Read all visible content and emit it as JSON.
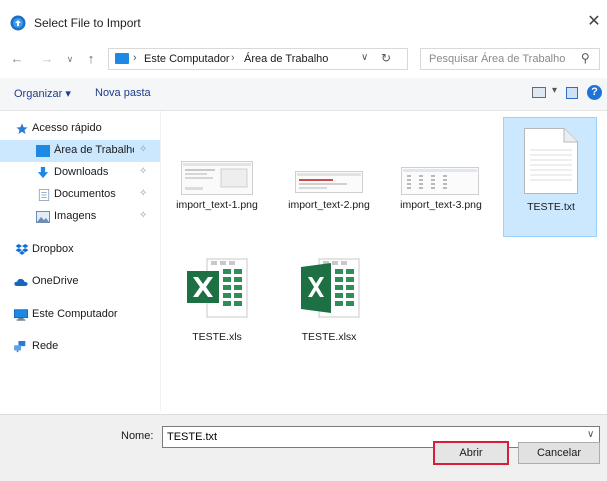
{
  "window": {
    "title": "Select File to Import",
    "close_glyph": "✕"
  },
  "nav": {
    "back": "←",
    "forward": "→",
    "recent": "∨",
    "up": "↑"
  },
  "address": {
    "separator": "›",
    "crumbs": [
      "Este Computador",
      "Área de Trabalho"
    ],
    "dropdown": "∨",
    "refresh": "↻"
  },
  "search": {
    "placeholder": "Pesquisar Área de Trabalho"
  },
  "toolbar": {
    "organize_label": "Organizar ▾",
    "new_folder_label": "Nova pasta",
    "view_dropdown": "▾",
    "help_label": "?"
  },
  "sidebar": {
    "pin_glyph": "✧",
    "items": [
      {
        "label": "Acesso rápido",
        "icon": "star-icon",
        "color": "#2a7bd6"
      },
      {
        "label": "Área de Trabalho",
        "icon": "desktop-icon",
        "color": "#1e88e5"
      },
      {
        "label": "Downloads",
        "icon": "download-icon",
        "color": "#1e88e5"
      },
      {
        "label": "Documentos",
        "icon": "documents-icon",
        "color": "#8aa2c0"
      },
      {
        "label": "Imagens",
        "icon": "images-icon",
        "color": "#6f8db3"
      },
      {
        "label": "Dropbox",
        "icon": "dropbox-icon",
        "color": "#0d6eda"
      },
      {
        "label": "OneDrive",
        "icon": "onedrive-icon",
        "color": "#1565c0"
      },
      {
        "label": "Este Computador",
        "icon": "computer-icon",
        "color": "#1e88e5"
      },
      {
        "label": "Rede",
        "icon": "network-icon",
        "color": "#2a7bd6"
      }
    ]
  },
  "files": [
    {
      "name": "import_text-1.png",
      "type": "png-screenshot"
    },
    {
      "name": "import_text-2.png",
      "type": "png-screenshot"
    },
    {
      "name": "import_text-3.png",
      "type": "png-screenshot"
    },
    {
      "name": "TESTE.txt",
      "type": "text-document",
      "selected": true
    },
    {
      "name": "TESTE.xls",
      "type": "excel-workbook"
    },
    {
      "name": "TESTE.xlsx",
      "type": "excel-workbook"
    }
  ],
  "footer": {
    "name_label": "Nome:",
    "name_value": "TESTE.txt",
    "dropdown": "∨",
    "open_label": "Abrir",
    "cancel_label": "Cancelar"
  },
  "colors": {
    "selection": "#cce8ff",
    "highlight_border": "#d81e3a",
    "excel_green": "#1d7044"
  }
}
